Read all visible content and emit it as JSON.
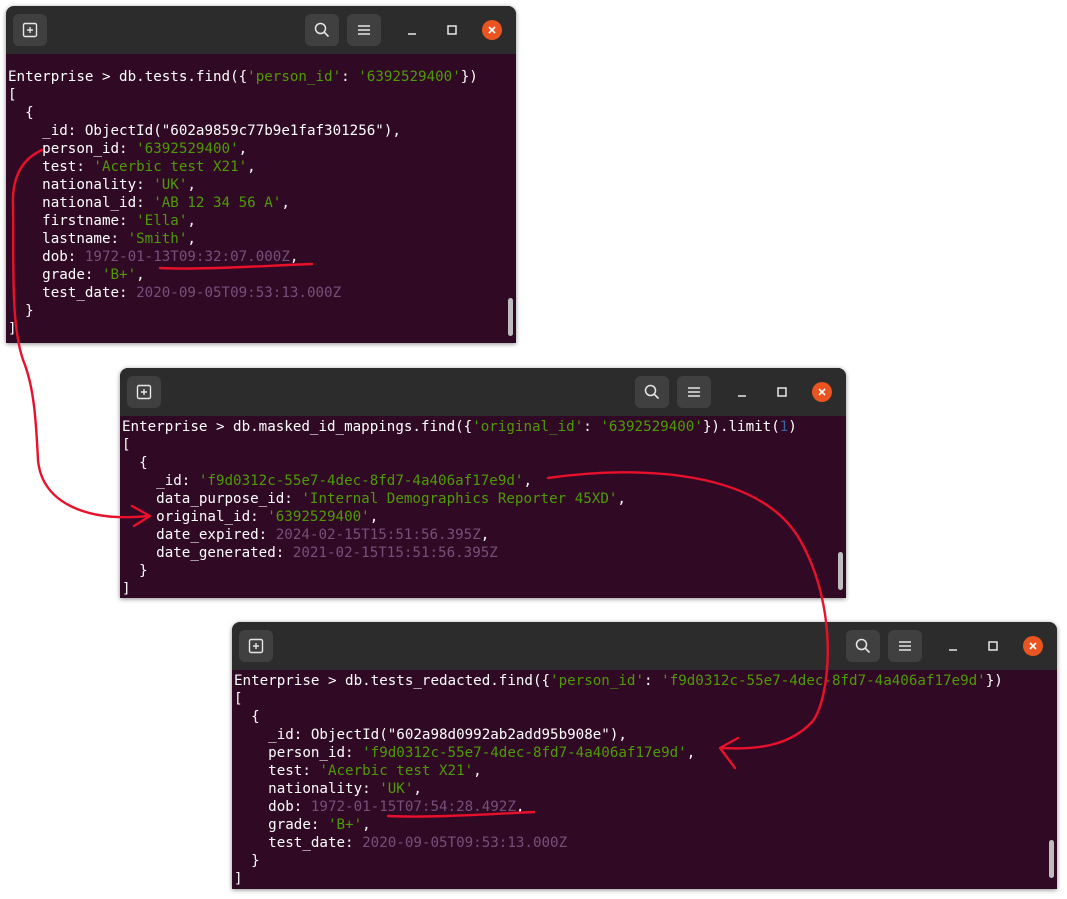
{
  "windows": [
    {
      "id": "w1",
      "lines": [
        [
          {
            "t": "Enterprise > db.tests.find({",
            "c": "w"
          },
          {
            "t": "'person_id'",
            "c": "g"
          },
          {
            "t": ": ",
            "c": "w"
          },
          {
            "t": "'6392529400'",
            "c": "g"
          },
          {
            "t": "})",
            "c": "w"
          }
        ],
        [
          {
            "t": "[",
            "c": "w"
          }
        ],
        [
          {
            "t": "  {",
            "c": "w"
          }
        ],
        [
          {
            "t": "    _id: ObjectId(\"602a9859c77b9e1faf301256\"),",
            "c": "w"
          }
        ],
        [
          {
            "t": "    person_id: ",
            "c": "w"
          },
          {
            "t": "'6392529400'",
            "c": "g"
          },
          {
            "t": ",",
            "c": "w"
          }
        ],
        [
          {
            "t": "    test: ",
            "c": "w"
          },
          {
            "t": "'Acerbic test X21'",
            "c": "g"
          },
          {
            "t": ",",
            "c": "w"
          }
        ],
        [
          {
            "t": "    nationality: ",
            "c": "w"
          },
          {
            "t": "'UK'",
            "c": "g"
          },
          {
            "t": ",",
            "c": "w"
          }
        ],
        [
          {
            "t": "    national_id: ",
            "c": "w"
          },
          {
            "t": "'AB 12 34 56 A'",
            "c": "g"
          },
          {
            "t": ",",
            "c": "w"
          }
        ],
        [
          {
            "t": "    firstname: ",
            "c": "w"
          },
          {
            "t": "'Ella'",
            "c": "g"
          },
          {
            "t": ",",
            "c": "w"
          }
        ],
        [
          {
            "t": "    lastname: ",
            "c": "w"
          },
          {
            "t": "'Smith'",
            "c": "g"
          },
          {
            "t": ",",
            "c": "w"
          }
        ],
        [
          {
            "t": "    dob: ",
            "c": "w"
          },
          {
            "t": "1972-01-13T09:32:07.000Z",
            "c": "d"
          },
          {
            "t": ",",
            "c": "w"
          }
        ],
        [
          {
            "t": "    grade: ",
            "c": "w"
          },
          {
            "t": "'B+'",
            "c": "g"
          },
          {
            "t": ",",
            "c": "w"
          }
        ],
        [
          {
            "t": "    test_date: ",
            "c": "w"
          },
          {
            "t": "2020-09-05T09:53:13.000Z",
            "c": "d"
          }
        ],
        [
          {
            "t": "  }",
            "c": "w"
          }
        ],
        [
          {
            "t": "]",
            "c": "w"
          }
        ]
      ]
    },
    {
      "id": "w2",
      "lines": [
        [
          {
            "t": "Enterprise > db.masked_id_mappings.find({",
            "c": "w"
          },
          {
            "t": "'original_id'",
            "c": "g"
          },
          {
            "t": ": ",
            "c": "w"
          },
          {
            "t": "'6392529400'",
            "c": "g"
          },
          {
            "t": "}).limit(",
            "c": "w"
          },
          {
            "t": "1",
            "c": "b"
          },
          {
            "t": ")",
            "c": "w"
          }
        ],
        [
          {
            "t": "[",
            "c": "w"
          }
        ],
        [
          {
            "t": "  {",
            "c": "w"
          }
        ],
        [
          {
            "t": "    _id: ",
            "c": "w"
          },
          {
            "t": "'f9d0312c-55e7-4dec-8fd7-4a406af17e9d'",
            "c": "g"
          },
          {
            "t": ",",
            "c": "w"
          }
        ],
        [
          {
            "t": "    data_purpose_id: ",
            "c": "w"
          },
          {
            "t": "'Internal Demographics Reporter 45XD'",
            "c": "g"
          },
          {
            "t": ",",
            "c": "w"
          }
        ],
        [
          {
            "t": "    original_id: ",
            "c": "w"
          },
          {
            "t": "'6392529400'",
            "c": "g"
          },
          {
            "t": ",",
            "c": "w"
          }
        ],
        [
          {
            "t": "    date_expired: ",
            "c": "w"
          },
          {
            "t": "2024-02-15T15:51:56.395Z",
            "c": "d"
          },
          {
            "t": ",",
            "c": "w"
          }
        ],
        [
          {
            "t": "    date_generated: ",
            "c": "w"
          },
          {
            "t": "2021-02-15T15:51:56.395Z",
            "c": "d"
          }
        ],
        [
          {
            "t": "  }",
            "c": "w"
          }
        ],
        [
          {
            "t": "]",
            "c": "w"
          }
        ]
      ]
    },
    {
      "id": "w3",
      "lines": [
        [
          {
            "t": "Enterprise > db.tests_redacted.find({",
            "c": "w"
          },
          {
            "t": "'person_id'",
            "c": "g"
          },
          {
            "t": ": ",
            "c": "w"
          },
          {
            "t": "'f9d0312c-55e7-4dec-8fd7-4a406af17e9d'",
            "c": "g"
          },
          {
            "t": "})",
            "c": "w"
          }
        ],
        [
          {
            "t": "[",
            "c": "w"
          }
        ],
        [
          {
            "t": "  {",
            "c": "w"
          }
        ],
        [
          {
            "t": "    _id: ObjectId(\"602a98d0992ab2add95b908e\"),",
            "c": "w"
          }
        ],
        [
          {
            "t": "    person_id: ",
            "c": "w"
          },
          {
            "t": "'f9d0312c-55e7-4dec-8fd7-4a406af17e9d'",
            "c": "g"
          },
          {
            "t": ",",
            "c": "w"
          }
        ],
        [
          {
            "t": "    test: ",
            "c": "w"
          },
          {
            "t": "'Acerbic test X21'",
            "c": "g"
          },
          {
            "t": ",",
            "c": "w"
          }
        ],
        [
          {
            "t": "    nationality: ",
            "c": "w"
          },
          {
            "t": "'UK'",
            "c": "g"
          },
          {
            "t": ",",
            "c": "w"
          }
        ],
        [
          {
            "t": "    dob: ",
            "c": "w"
          },
          {
            "t": "1972-01-15T07:54:28.492Z",
            "c": "d"
          },
          {
            "t": ",",
            "c": "w"
          }
        ],
        [
          {
            "t": "    grade: ",
            "c": "w"
          },
          {
            "t": "'B+'",
            "c": "g"
          },
          {
            "t": ",",
            "c": "w"
          }
        ],
        [
          {
            "t": "    test_date: ",
            "c": "w"
          },
          {
            "t": "2020-09-05T09:53:13.000Z",
            "c": "d"
          }
        ],
        [
          {
            "t": "  }",
            "c": "w"
          }
        ],
        [
          {
            "t": "]",
            "c": "w"
          }
        ]
      ]
    }
  ],
  "colors": {
    "terminal_bg": "#300a24",
    "titlebar_bg": "#2c2c2c",
    "string_green": "#4e9a06",
    "date_purple": "#75507b",
    "number_blue": "#3465a4",
    "close_orange": "#e95420",
    "annotation_red": "#e8102a"
  },
  "icons": {
    "new_tab": "new-tab-icon",
    "search": "search-icon",
    "menu": "hamburger-menu-icon",
    "minimize": "minimize-icon",
    "maximize": "maximize-icon",
    "close": "close-icon"
  }
}
